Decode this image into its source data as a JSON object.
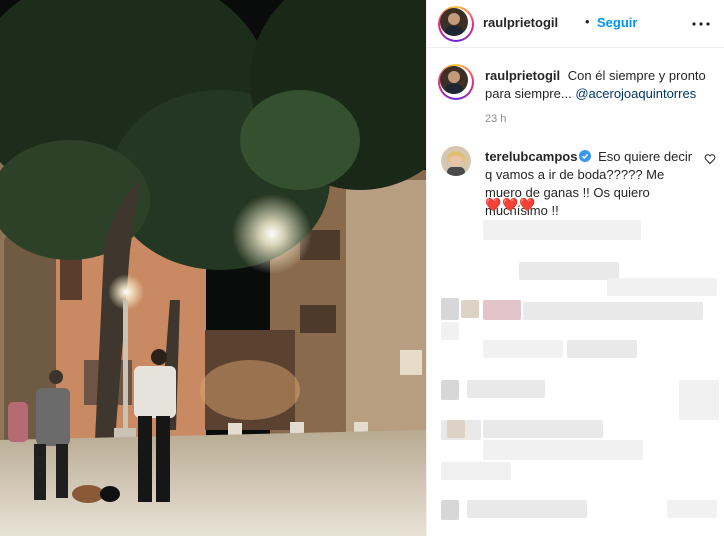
{
  "post": {
    "username": "raulprietogil",
    "separator": "•",
    "follow_label": "Seguir",
    "more_icon": "more-horizontal-icon"
  },
  "caption": {
    "username": "raulprietogil",
    "text": "Con él siempre y pronto para siempre...",
    "mention": "@acerojoaquintorres",
    "time": "23 h"
  },
  "comment": {
    "username": "terelubcampos",
    "verified": true,
    "text": "Eso quiere decir q vamos a ir de boda????? Me muero de ganas !! Os quiero muchísimo !!",
    "hearts": "❤️❤️❤️"
  },
  "colors": {
    "link": "#0095f6",
    "mention": "#00376b",
    "heart": "#ed4956",
    "timestamp": "#8e8e8e"
  }
}
